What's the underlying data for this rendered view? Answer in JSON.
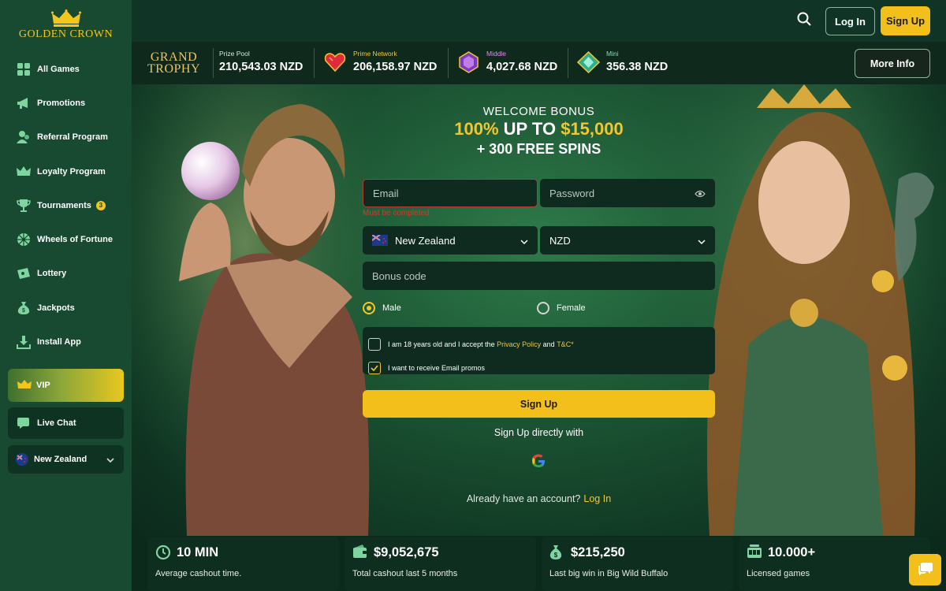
{
  "brand": {
    "logo_text": "GOLDEN CROWN"
  },
  "sidebar": {
    "items": [
      {
        "label": "All Games",
        "icon": "grid-icon"
      },
      {
        "label": "Promotions",
        "icon": "megaphone-icon"
      },
      {
        "label": "Referral Program",
        "icon": "users-icon"
      },
      {
        "label": "Loyalty Program",
        "icon": "crown-icon"
      },
      {
        "label": "Tournaments",
        "icon": "trophy-icon",
        "badge": "3"
      },
      {
        "label": "Wheels of Fortune",
        "icon": "wheel-icon"
      },
      {
        "label": "Lottery",
        "icon": "ticket-icon"
      },
      {
        "label": "Jackpots",
        "icon": "money-bag-icon"
      },
      {
        "label": "Install App",
        "icon": "download-icon"
      }
    ],
    "vip_label": "VIP",
    "live_chat_label": "Live Chat",
    "country_label": "New Zealand"
  },
  "header": {
    "login_label": "Log In",
    "signup_label": "Sign Up"
  },
  "jackpots": {
    "brand_line1": "GRAND",
    "brand_line2": "TROPHY",
    "items": [
      {
        "label": "Prize Pool",
        "amount": "210,543.03 NZD",
        "color": "#ffffff"
      },
      {
        "label": "Prime Network",
        "amount": "206,158.97 NZD",
        "color": "#f3c62d"
      },
      {
        "label": "Middle",
        "amount": "4,027.68 NZD",
        "color": "#e38cf0"
      },
      {
        "label": "Mini",
        "amount": "356.38 NZD",
        "color": "#7fe0c4"
      }
    ],
    "more_info_label": "More Info"
  },
  "hero": {
    "welcome_line": "WELCOME BONUS",
    "bonus_pct": "100%",
    "bonus_mid": " UP TO ",
    "bonus_amount": "$15,000",
    "free_spins": "+ 300 FREE SPINS"
  },
  "form": {
    "email_placeholder": "Email",
    "email_error": "Must be completed",
    "password_placeholder": "Password",
    "country_value": "New Zealand",
    "currency_value": "NZD",
    "bonus_code_placeholder": "Bonus code",
    "gender_male": "Male",
    "gender_female": "Female",
    "gender_selected": "Male",
    "agree_prefix": "I am 18 years old and I accept the",
    "privacy_link": "Privacy Policy",
    "and_word": "and",
    "tc_link": "T&C",
    "tc_suffix": "*",
    "agree_checked": false,
    "email_promos_label": "I want to receive Email promos",
    "email_promos_checked": true,
    "signup_label": "Sign Up",
    "signup_direct": "Sign Up directly with",
    "already_text": "Already have an account?",
    "login_link": "Log In"
  },
  "stats": [
    {
      "value": "10 MIN",
      "label": "Average cashout time.",
      "icon": "clock-icon"
    },
    {
      "value": "$9,052,675",
      "label": "Total cashout last 5 months",
      "icon": "wallet-icon"
    },
    {
      "value": "$215,250",
      "label": "Last big win in Big Wild Buffalo",
      "icon": "money-bag-icon"
    },
    {
      "value": "10.000+",
      "label": "Licensed games",
      "icon": "slot-machine-icon"
    }
  ],
  "colors": {
    "accent": "#f3c01b",
    "sidebar_bg": "#174a30",
    "page_bg": "#0c2a1c",
    "error": "#e0322a"
  }
}
